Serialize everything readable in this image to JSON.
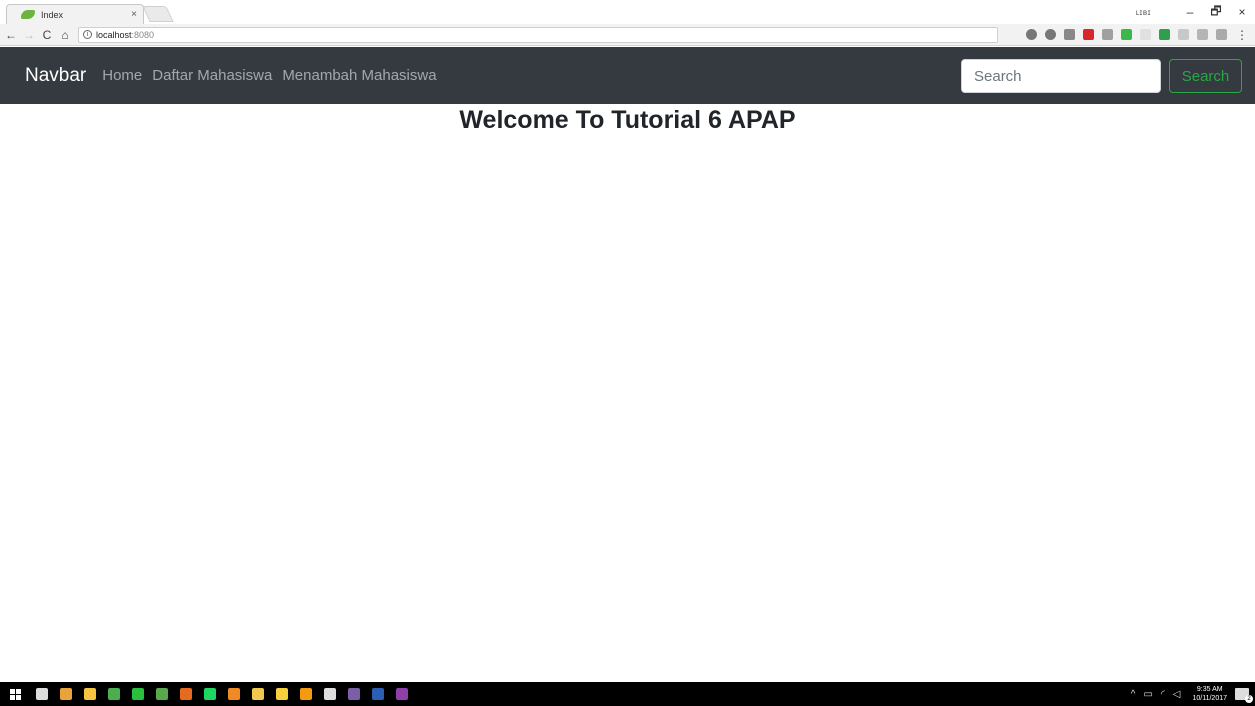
{
  "browser": {
    "tab": {
      "title": "Index",
      "close_glyph": "×"
    },
    "window_user": "ʟɪʙɪ",
    "window_controls": {
      "minimize": "–",
      "maximize": "🗗",
      "close": "×"
    },
    "nav": {
      "back": "←",
      "forward": "→",
      "reload": "C",
      "home": "⌂"
    },
    "address": {
      "info_glyph": "i",
      "url_host": "localhost",
      "url_port": ":8080"
    },
    "extensions": [
      {
        "name": "zoom-icon",
        "color": "#777777"
      },
      {
        "name": "star-icon",
        "color": "#777777"
      },
      {
        "name": "camera-extension-icon",
        "color": "#888888"
      },
      {
        "name": "red-extension-icon",
        "color": "#d9262b"
      },
      {
        "name": "gray-extension-icon",
        "color": "#a0a0a0"
      },
      {
        "name": "green-ring-extension-icon",
        "color": "#3cb84a"
      },
      {
        "name": "faded-extension-icon",
        "color": "#e0e0e0"
      },
      {
        "name": "green-extension-icon",
        "color": "#2e9f4c"
      },
      {
        "name": "light-extension-icon",
        "color": "#c8c8c8"
      },
      {
        "name": "wave-extension-icon",
        "color": "#b5b5b5"
      },
      {
        "name": "window-extension-icon",
        "color": "#aaaaaa"
      }
    ],
    "menu_glyph": "⋮"
  },
  "navbar": {
    "brand": "Navbar",
    "links": [
      "Home",
      "Daftar Mahasiswa",
      "Menambah Mahasiswa"
    ],
    "search": {
      "placeholder": "Search",
      "button_label": "Search"
    },
    "colors": {
      "background": "#343a40",
      "success": "#28a745"
    }
  },
  "main": {
    "heading": "Welcome To Tutorial 6 APAP"
  },
  "taskbar": {
    "apps": [
      {
        "name": "task-view-icon",
        "color": "#dddddd"
      },
      {
        "name": "chrome-icon",
        "color": "#e8a33b"
      },
      {
        "name": "file-explorer-icon",
        "color": "#f5c542"
      },
      {
        "name": "edge-icon",
        "color": "#4cae4f"
      },
      {
        "name": "line-icon",
        "color": "#2bbf3e"
      },
      {
        "name": "notes-icon",
        "color": "#59a84b"
      },
      {
        "name": "firefox-icon",
        "color": "#e66b21"
      },
      {
        "name": "spotify-icon",
        "color": "#1ed760"
      },
      {
        "name": "sublime-icon",
        "color": "#f08a24"
      },
      {
        "name": "sticky-notes-icon",
        "color": "#f2c94c"
      },
      {
        "name": "postman-icon",
        "color": "#f5d13d"
      },
      {
        "name": "xampp-icon",
        "color": "#f39c12"
      },
      {
        "name": "alarm-icon",
        "color": "#dddddd"
      },
      {
        "name": "game-icon",
        "color": "#7a5fa6"
      },
      {
        "name": "word-icon",
        "color": "#2b5fb4"
      },
      {
        "name": "onenote-icon",
        "color": "#8e3fa8"
      }
    ],
    "tray": {
      "chevron": "^",
      "network": "▭",
      "wifi": "◜",
      "volume": "◁"
    },
    "clock": {
      "time": "9:35 AM",
      "date": "10/11/2017"
    },
    "notification_count": "2"
  }
}
